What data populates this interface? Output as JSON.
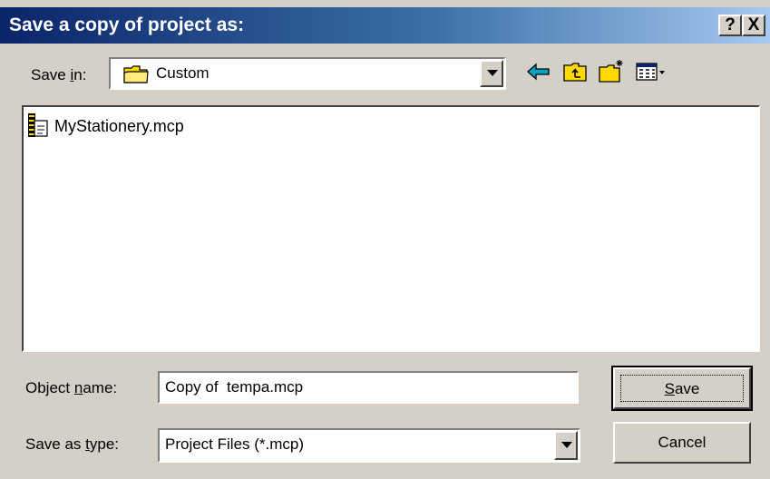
{
  "dialog": {
    "title": "Save a copy of project as:",
    "help_glyph": "?",
    "close_glyph": "X"
  },
  "save_in": {
    "label_pre": "Save ",
    "label_accel": "i",
    "label_post": "n:",
    "value": "Custom",
    "icon": "folder-icon"
  },
  "toolbar": {
    "icons": [
      "back-arrow-icon",
      "up-one-level-icon",
      "create-new-folder-icon",
      "view-menu-icon"
    ]
  },
  "files": [
    {
      "name": "MyStationery.mcp",
      "icon": "project-file-icon"
    }
  ],
  "object_name": {
    "label_pre": "Object ",
    "label_accel": "n",
    "label_post": "ame:",
    "value": "Copy of  tempa.mcp"
  },
  "save_as_type": {
    "label_pre": "Save as ",
    "label_accel": "t",
    "label_post": "ype:",
    "value": "Project Files (*.mcp)"
  },
  "buttons": {
    "save_accel": "S",
    "save_post": "ave",
    "cancel": "Cancel"
  },
  "colors": {
    "titlebar_start": "#0a246a",
    "titlebar_end": "#a6caf0",
    "face": "#d4d0c8",
    "back_arrow": "#00a0c0",
    "folder": "#ffd800"
  }
}
